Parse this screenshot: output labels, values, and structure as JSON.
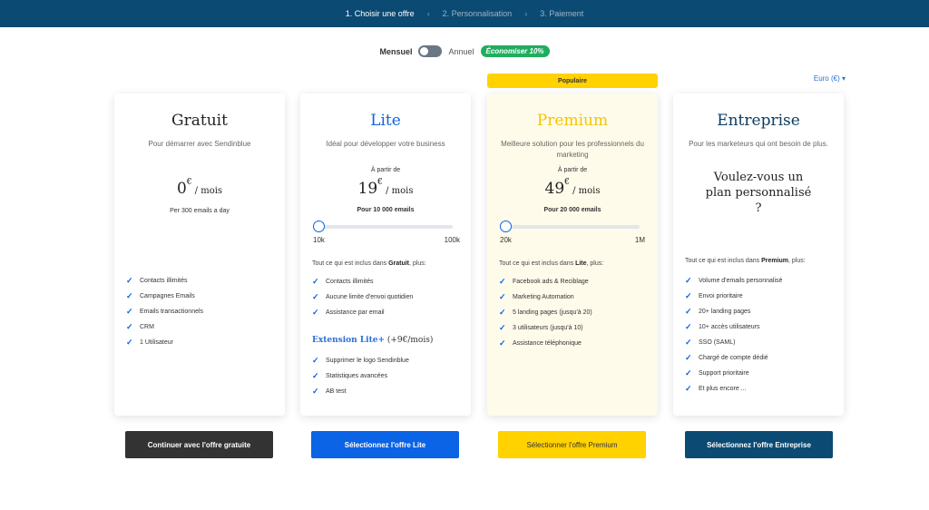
{
  "steps": [
    {
      "label": "1. Choisir une offre",
      "active": true
    },
    {
      "label": "2. Personnalisation",
      "active": false
    },
    {
      "label": "3. Paiement",
      "active": false
    }
  ],
  "step_separator": "›",
  "billing": {
    "monthly": "Mensuel",
    "annual": "Annuel",
    "save_badge": "Économiser 10%",
    "annual_selected": false
  },
  "currency": "Euro (€) ▾",
  "popular_label": "Populaire",
  "plans": {
    "gratuit": {
      "name": "Gratuit",
      "subtitle": "Pour démarrer avec Sendinblue",
      "price": "0",
      "currency_symbol": "€",
      "per": " / mois",
      "emails": "Per 300 emails a day",
      "features": [
        "Contacts illimités",
        "Campagnes Emails",
        "Emails transactionnels",
        "CRM",
        "1 Utilisateur"
      ],
      "cta": "Continuer avec l'offre gratuite"
    },
    "lite": {
      "name": "Lite",
      "subtitle": "Idéal pour développer votre business",
      "from": "À partir de",
      "price": "19",
      "currency_symbol": "€",
      "per": " / mois",
      "emails": "Pour 10 000 emails",
      "slider_min": "10k",
      "slider_max": "100k",
      "included_prefix": "Tout ce qui est inclus dans ",
      "included_plan": "Gratuit",
      "included_suffix": ", plus:",
      "features": [
        "Contacts illimités",
        "Aucune limite d'envoi quotidien",
        "Assistance par email"
      ],
      "extension_title": "Extension Lite+",
      "extension_price": " (+9€/mois)",
      "extension_features": [
        "Supprimer le logo Sendinblue",
        "Statistiques avancées",
        "AB test"
      ],
      "cta": "Sélectionnez l'offre Lite"
    },
    "premium": {
      "name": "Premium",
      "subtitle": "Meilleure solution pour les professionnels du marketing",
      "from": "À partir de",
      "price": "49",
      "currency_symbol": "€",
      "per": " / mois",
      "emails": "Pour 20 000 emails",
      "slider_min": "20k",
      "slider_max": "1M",
      "included_prefix": "Tout ce qui est inclus dans ",
      "included_plan": "Lite",
      "included_suffix": ", plus:",
      "features": [
        "Facebook ads & Reciblage",
        "Marketing Automation",
        "5 landing pages (jusqu'à 20)",
        "3 utilisateurs (jusqu'à 10)",
        "Assistance téléphonique"
      ],
      "cta": "Sélectionner l'offre Premium"
    },
    "entreprise": {
      "name": "Entreprise",
      "subtitle": "Pour les marketeurs qui ont besoin de plus.",
      "custom_line1": "Voulez-vous un",
      "custom_line2": "plan personnalisé",
      "custom_line3": "?",
      "included_prefix": "Tout ce qui est inclus dans ",
      "included_plan": "Premium",
      "included_suffix": ", plus:",
      "features": [
        "Volume d'emails personnalisé",
        "Envoi prioritaire",
        "20+ landing pages",
        "10+ accès utilisateurs",
        "SSO (SAML)",
        "Chargé de compte dédié",
        "Support prioritaire",
        "Et plus encore ..."
      ],
      "cta": "Sélectionnez l'offre Entreprise"
    }
  },
  "slider_level": 0
}
